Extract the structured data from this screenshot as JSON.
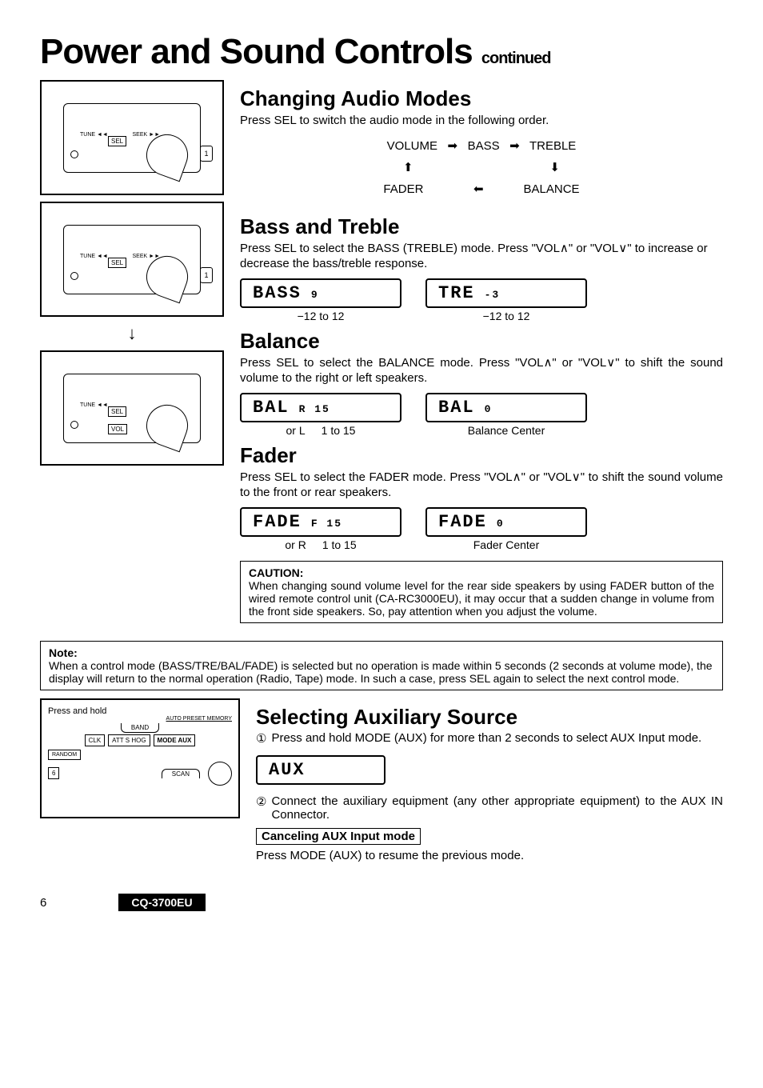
{
  "title": "Power and Sound Controls",
  "continued": "continued",
  "sections": {
    "changing_modes": {
      "heading": "Changing Audio Modes",
      "text": "Press SEL to switch the audio mode in the following order.",
      "cycle": [
        "VOLUME",
        "BASS",
        "TREBLE",
        "BALANCE",
        "FADER"
      ]
    },
    "bass_treble": {
      "heading": "Bass and Treble",
      "text": "Press SEL to select the BASS (TREBLE) mode. Press \"VOL∧\" or \"VOL∨\" to increase or decrease the bass/treble response.",
      "bass_lcd": "BASS",
      "bass_val": "9",
      "bass_range": "−12 to 12",
      "tre_lcd": "TRE",
      "tre_val": "-3",
      "tre_range": "−12 to 12"
    },
    "balance": {
      "heading": "Balance",
      "text": "Press SEL to select the BALANCE mode. Press \"VOL∧\" or \"VOL∨\" to shift the sound volume to the right or left speakers.",
      "bal1_lcd": "BAL",
      "bal1_val": "R 15",
      "bal1_sub1": "or L",
      "bal1_sub2": "1 to 15",
      "bal2_lcd": "BAL",
      "bal2_val": "0",
      "bal2_sub": "Balance Center"
    },
    "fader": {
      "heading": "Fader",
      "text": "Press SEL to select the FADER mode. Press \"VOL∧\" or \"VOL∨\" to shift the sound volume to the front or rear speakers.",
      "fad1_lcd": "FADE",
      "fad1_val": "F 15",
      "fad1_sub1": "or R",
      "fad1_sub2": "1 to 15",
      "fad2_lcd": "FADE",
      "fad2_val": "0",
      "fad2_sub": "Fader Center"
    },
    "caution": {
      "label": "CAUTION:",
      "text": "When changing sound volume level for the rear side speakers by using FADER button of the wired remote control unit (CA-RC3000EU), it may occur that a sudden change in volume from the front side speakers. So, pay attention when you adjust the volume."
    },
    "note": {
      "label": "Note:",
      "text": "When a control mode (BASS/TRE/BAL/FADE) is selected but no operation is made within 5 seconds (2 seconds at volume mode), the display will return to the normal operation (Radio, Tape) mode. In such a case, press SEL again to select the next control mode."
    },
    "aux": {
      "heading": "Selecting Auxiliary Source",
      "step1": "Press and hold MODE (AUX) for more than 2 seconds to select AUX Input mode.",
      "aux_lcd": "AUX",
      "step2": "Connect the auxiliary equipment (any other appropriate equipment) to the AUX IN Connector.",
      "cancel_label": "Canceling AUX Input mode",
      "cancel_text": "Press MODE (AUX) to resume the previous mode."
    }
  },
  "figures": {
    "panel_labels": {
      "sel": "SEL",
      "tune": "TUNE ◄◄",
      "seek": "SEEK ►►",
      "vol": "VOL",
      "btn1": "1"
    },
    "fig4": {
      "press_hold": "Press and hold",
      "auto_preset": "AUTO PRESET MEMORY",
      "band": "BAND",
      "clk": "CLK",
      "att": "ATT S HOG",
      "mode_aux": "MODE AUX",
      "random": "RANDOM",
      "six": "6",
      "scan": "SCAN"
    }
  },
  "footer": {
    "page": "6",
    "model": "CQ-3700EU"
  }
}
